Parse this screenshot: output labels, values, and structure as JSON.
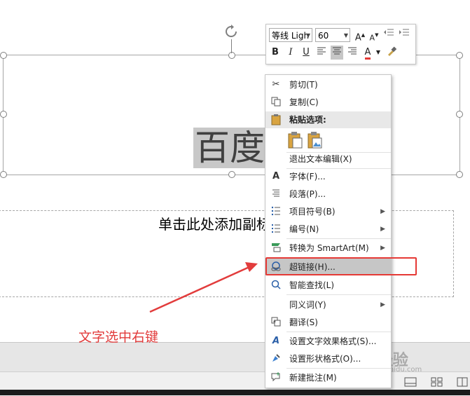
{
  "slide": {
    "title_text": "百度经验",
    "subtitle_text": "单击此处添加副标题"
  },
  "mini_toolbar": {
    "font_name": "等线 Ligh",
    "font_size": "60",
    "buttons": [
      "B",
      "I",
      "U"
    ]
  },
  "context_menu": {
    "items": [
      {
        "label": "剪切(T)",
        "icon": "scissors-icon"
      },
      {
        "label": "复制(C)",
        "icon": "copy-icon"
      },
      {
        "label": "粘贴选项:",
        "icon": "paste-icon"
      },
      {
        "label": "退出文本编辑(X)",
        "icon": ""
      },
      {
        "label": "字体(F)...",
        "icon": "font-icon"
      },
      {
        "label": "段落(P)...",
        "icon": "paragraph-icon"
      },
      {
        "label": "项目符号(B)",
        "icon": "bullets-icon"
      },
      {
        "label": "编号(N)",
        "icon": "numbering-icon"
      },
      {
        "label": "转换为 SmartArt(M)",
        "icon": "smartart-icon"
      },
      {
        "label": "超链接(H)...",
        "icon": "hyperlink-icon"
      },
      {
        "label": "智能查找(L)",
        "icon": "smart-lookup-icon"
      },
      {
        "label": "同义词(Y)",
        "icon": ""
      },
      {
        "label": "翻译(S)",
        "icon": "translate-icon"
      },
      {
        "label": "设置文字效果格式(S)...",
        "icon": "text-effects-icon"
      },
      {
        "label": "设置形状格式(O)...",
        "icon": "shape-format-icon"
      },
      {
        "label": "新建批注(M)",
        "icon": "new-comment-icon"
      }
    ]
  },
  "annotation": {
    "caption": "文字选中右键"
  },
  "watermark": {
    "brand": "Bai 经验",
    "url": "jingyan.baidu.com"
  },
  "colors": {
    "annotation_red": "#e23c3c",
    "highlight_gray": "#c6c6c6",
    "font_color_red": "#e53935"
  }
}
